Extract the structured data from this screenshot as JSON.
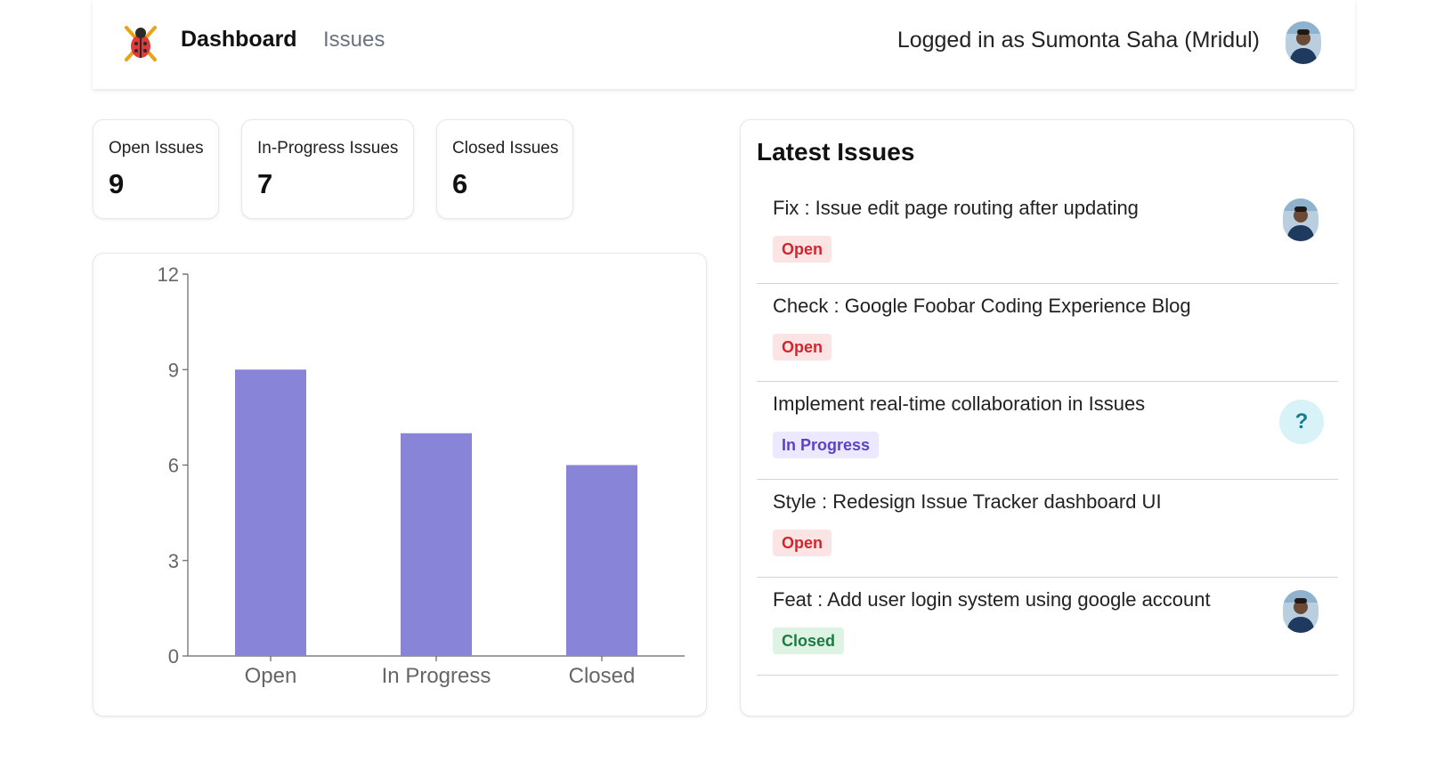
{
  "nav": {
    "brand_icon": "bug-icon",
    "dashboard_label": "Dashboard",
    "issues_label": "Issues",
    "user_label": "Logged in as Sumonta Saha (Mridul)"
  },
  "stats": [
    {
      "label": "Open Issues",
      "value": "9"
    },
    {
      "label": "In-Progress Issues",
      "value": "7"
    },
    {
      "label": "Closed Issues",
      "value": "6"
    }
  ],
  "chart_data": {
    "type": "bar",
    "categories": [
      "Open",
      "In Progress",
      "Closed"
    ],
    "values": [
      9,
      7,
      6
    ],
    "ylim": [
      0,
      12
    ],
    "yticks": [
      0,
      3,
      6,
      9,
      12
    ],
    "bar_color": "#8884d8",
    "grid": false
  },
  "latest": {
    "title": "Latest Issues",
    "issues": [
      {
        "title": "Fix : Issue edit page routing after updating",
        "status": "Open",
        "assignee": "user-avatar"
      },
      {
        "title": "Check : Google Foobar Coding Experience Blog",
        "status": "Open",
        "assignee": ""
      },
      {
        "title": "Implement real-time collaboration in Issues",
        "status": "In Progress",
        "assignee": "?"
      },
      {
        "title": "Style : Redesign Issue Tracker dashboard UI",
        "status": "Open",
        "assignee": ""
      },
      {
        "title": "Feat : Add user login system using google account",
        "status": "Closed",
        "assignee": "user-avatar"
      }
    ]
  },
  "colors": {
    "open_bg": "#fde4e4",
    "open_fg": "#d0262e",
    "progress_bg": "#ece8ff",
    "progress_fg": "#5b44c4",
    "closed_bg": "#dff3e4",
    "closed_fg": "#1d7a45"
  }
}
